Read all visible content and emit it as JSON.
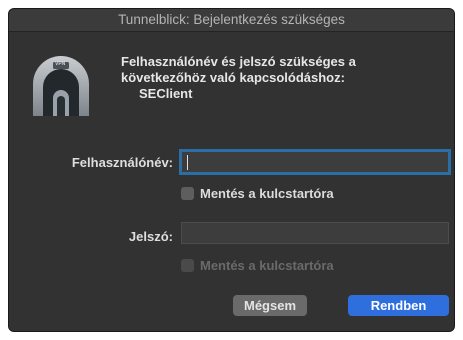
{
  "window": {
    "title": "Tunnelblick: Bejelentkezés szükséges"
  },
  "logo": {
    "badge": "VPN",
    "icon": "tunnelblick-logo-icon"
  },
  "message": {
    "line1": "Felhasználónév és jelszó szükséges a",
    "line2": "következőhöz való kapcsolódáshoz:",
    "line3": "SEClient"
  },
  "username": {
    "label": "Felhasználónév:",
    "value": "",
    "placeholder": ""
  },
  "save_username": {
    "label": "Mentés a kulcstartóra",
    "checked": false,
    "enabled": true
  },
  "password": {
    "label": "Jelszó:",
    "value": "",
    "placeholder": ""
  },
  "save_password": {
    "label": "Mentés a kulcstartóra",
    "checked": false,
    "enabled": false
  },
  "buttons": {
    "cancel": "Mégsem",
    "ok": "Rendben"
  },
  "colors": {
    "accent": "#2f6fdd",
    "focus_ring": "#2b6ea6",
    "background": "#323232"
  }
}
